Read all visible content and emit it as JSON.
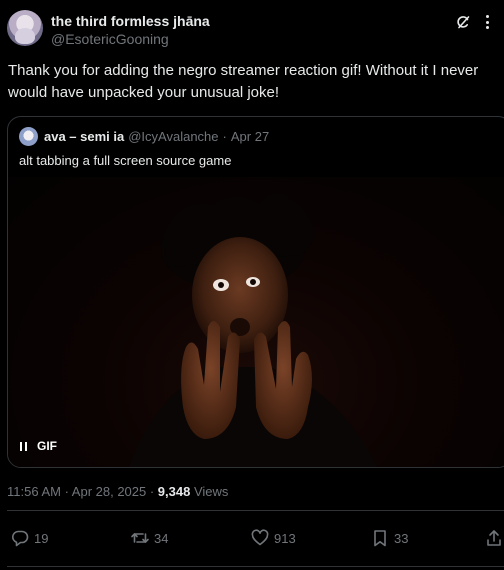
{
  "author": {
    "display_name": "the third formless jhāna",
    "handle": "@EsotericGooning"
  },
  "tweet": {
    "text": "Thank you for adding the negro streamer reaction gif! Without it I never would have unpacked your unusual joke!"
  },
  "quoted": {
    "display_name": "ava – semi ia",
    "handle": "@IcyAvalanche",
    "separator": "·",
    "date": "Apr 27",
    "text": "alt tabbing a full screen source game",
    "media": {
      "type": "gif",
      "badge": "GIF"
    }
  },
  "meta": {
    "timestamp": "11:56 AM · Apr 28, 2025 · ",
    "views_count": "9,348",
    "views_label": " Views"
  },
  "actions": {
    "replies": "19",
    "reposts": "34",
    "likes": "913",
    "bookmarks": "33"
  },
  "colors": {
    "background": "#000000",
    "text": "#e7e9ea",
    "muted": "#71767b",
    "border": "#2f3336"
  },
  "icons": [
    "grok-icon",
    "more-icon",
    "pause-icon",
    "reply-icon",
    "repost-icon",
    "like-icon",
    "bookmark-icon",
    "share-icon"
  ]
}
